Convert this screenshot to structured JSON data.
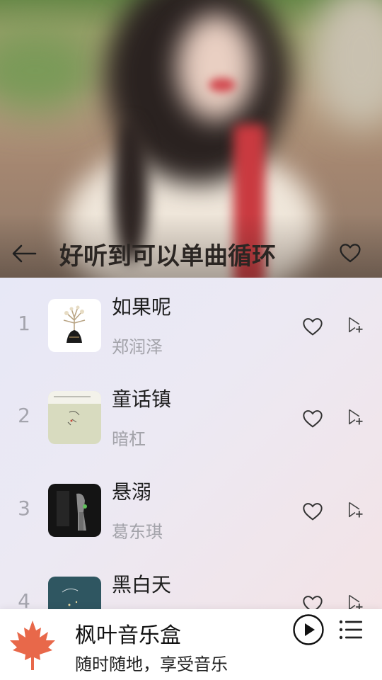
{
  "header": {
    "title": "好听到可以单曲循环",
    "icons": {
      "back": "arrow-left-icon",
      "favorite": "heart-outline-icon"
    }
  },
  "songs": [
    {
      "index": "1",
      "title": "如果呢",
      "artist": "郑润泽",
      "cover": "cover-flower-white"
    },
    {
      "index": "2",
      "title": "童话镇",
      "artist": "暗杠",
      "cover": "cover-sage-sketch"
    },
    {
      "index": "3",
      "title": "悬溺",
      "artist": "葛东琪",
      "cover": "cover-dark-figure"
    },
    {
      "index": "4",
      "title": "黑白天",
      "artist": "",
      "cover": "cover-night-sky"
    }
  ],
  "row_icons": {
    "like": "heart-outline-icon",
    "add_to_playlist": "playlist-add-icon"
  },
  "player": {
    "app_name": "枫叶音乐盒",
    "slogan": "随时随地，享受音乐",
    "logo": "maple-leaf-icon",
    "accent": "#e8684a",
    "icons": {
      "play": "play-circle-icon",
      "playlist": "menu-list-icon"
    }
  }
}
